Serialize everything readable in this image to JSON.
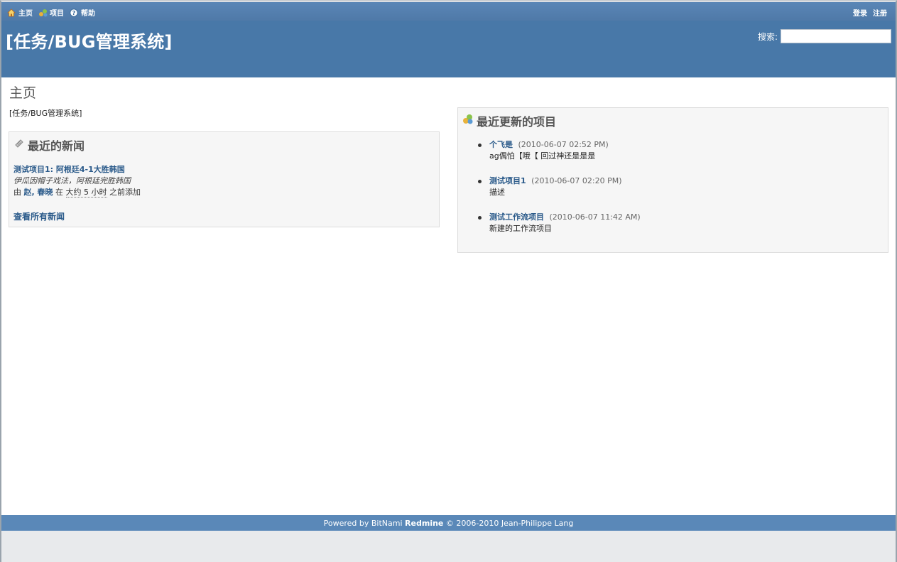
{
  "top_menu": {
    "home": "主页",
    "projects": "项目",
    "help": "帮助",
    "login": "登录",
    "register": "注册"
  },
  "header": {
    "title": "[任务/BUG管理系统]",
    "search_label": "搜索:",
    "search_value": ""
  },
  "main": {
    "page_title": "主页",
    "welcome": "[任务/BUG管理系统]",
    "news": {
      "heading": "最近的新闻",
      "items": [
        {
          "title": "测试项目1: 阿根廷4-1大胜韩国",
          "summary": "伊瓜因帽子戏法，阿根廷完胜韩国",
          "by_prefix": "由",
          "author": "赵, 春晓",
          "in_text": "在",
          "ago": "大约 5 小时",
          "suffix": "之前添加"
        }
      ],
      "view_all": "查看所有新闻"
    },
    "projects": {
      "heading": "最近更新的项目",
      "items": [
        {
          "name": "个飞是",
          "date": "(2010-06-07 02:52 PM)",
          "description": "ag偶怕【哦【 回过神还是是是"
        },
        {
          "name": "测试项目1",
          "date": "(2010-06-07 02:20 PM)",
          "description": "描述"
        },
        {
          "name": "测试工作流项目",
          "date": "(2010-06-07 11:42 AM)",
          "description": "新建的工作流项目"
        }
      ]
    }
  },
  "footer": {
    "powered_by": "Powered by BitNami",
    "product": "Redmine",
    "copyright": "© 2006-2010 Jean-Philippe Lang"
  },
  "colors": {
    "top_menu": "#507aaa",
    "header": "#4878a8",
    "footer": "#5a88b8",
    "link": "#2a5a8a"
  }
}
